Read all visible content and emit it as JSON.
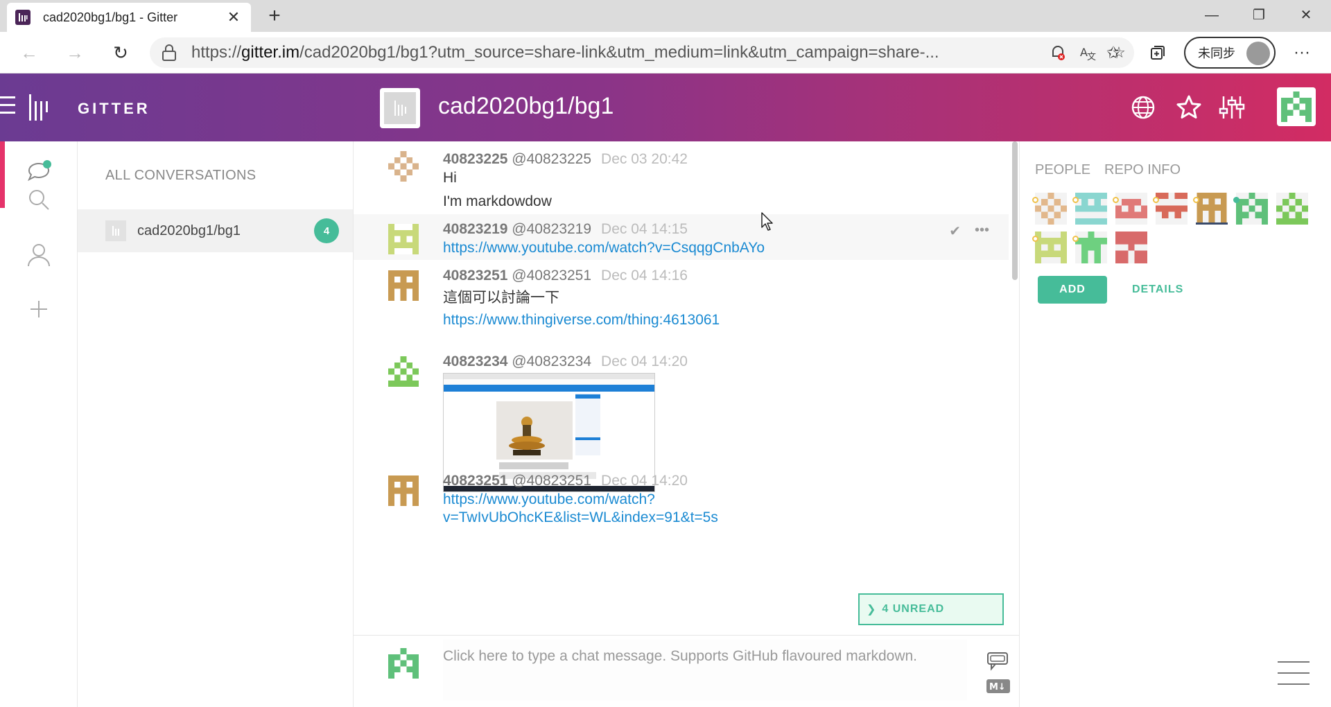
{
  "browser": {
    "tab_title": "cad2020bg1/bg1 - Gitter",
    "new_tab": "+",
    "url_prefix": "https://",
    "url_host": "gitter.im",
    "url_rest": "/cad2020bg1/bg1?utm_source=share-link&utm_medium=link&utm_campaign=share-...",
    "profile_label": "未同步",
    "more": "···"
  },
  "header": {
    "brand": "GITTER",
    "room_title": "cad2020bg1/bg1"
  },
  "conversations": {
    "title": "ALL CONVERSATIONS",
    "items": [
      {
        "name": "cad2020bg1/bg1",
        "badge": "4"
      }
    ]
  },
  "messages": [
    {
      "user": "40823225",
      "handle": "@40823225",
      "time": "Dec 03 20:42",
      "lines": [
        "Hi",
        "I'm markdowdow"
      ]
    },
    {
      "user": "40823219",
      "handle": "@40823219",
      "time": "Dec 04 14:15",
      "link": "https://www.youtube.com/watch?v=CsqqgCnbAYo"
    },
    {
      "user": "40823251",
      "handle": "@40823251",
      "time": "Dec 04 14:16",
      "text": "這個可以討論一下",
      "link": "https://www.thingiverse.com/thing:4613061"
    },
    {
      "user": "40823234",
      "handle": "@40823234",
      "time": "Dec 04 14:20"
    },
    {
      "user": "40823251",
      "handle": "@40823251",
      "time": "Dec 04 14:20",
      "link_line1": "https://www.youtube.com/watch?",
      "link_line2": "v=TwIvUbOhcKE&list=WL&index=91&t=5s"
    }
  ],
  "unread": {
    "label": "4 UNREAD"
  },
  "input": {
    "placeholder": "Click here to type a chat message. Supports GitHub flavoured markdown."
  },
  "right_panel": {
    "tabs": [
      "PEOPLE",
      "REPO INFO"
    ],
    "add_label": "ADD",
    "details_label": "DETAILS"
  },
  "colors": {
    "accent": "#46bc99",
    "link": "#1a8ad2",
    "header_start": "#6b3b92",
    "header_end": "#d22c63"
  }
}
